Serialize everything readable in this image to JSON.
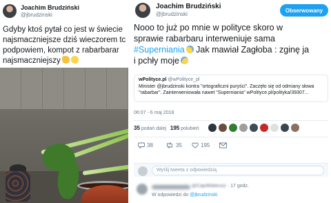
{
  "left_tweet": {
    "author_name": "Joachim Brudziński",
    "handle": "@jbrudzinski",
    "text_lines": [
      "Gdyby ktoś pytał co jest w świecie",
      "najsmaczniejsze dziś wieczorem tc",
      "podpowiem, kompot z rabarbarar",
      "najsmaczniejszy"
    ],
    "text_emojis": [
      "thumbs-up-emoji",
      "smile-emoji"
    ]
  },
  "right_tweet": {
    "author_name": "Joachim Brudziński",
    "handle": "@jbrudzinski",
    "follow_label": "Obserwowany",
    "text_line1": "Nooo to już po mnie w polityce skoro w",
    "text_line2": "sprawie rabarbaru interweniuje sama",
    "hashtag": "#Superniania",
    "text_line3_rest": " Jak mawiał Zagłoba : zginę ja",
    "text_line4": "i pchły moje",
    "quote": {
      "source_name": "wPolityce.pl",
      "source_handle": "@wPolityce_pl",
      "body_line1": "Minister @jbrudzinski kontra \"ortograficzni puryści\". Zaczęło się od odmiany słowa",
      "body_line2": "\"rabarbar\". Zainterweniowała nawet \"Superniania\" wPolityce.pl/polityka/39307..."
    },
    "timestamp": "06:07 - 6 maj 2018",
    "retweets_count": "35",
    "retweets_label": "podań dalej",
    "likes_count": "195",
    "likes_label": "polubień",
    "actions": {
      "reply_count": "38",
      "retweet_count": "35",
      "like_count": "195"
    },
    "reply_placeholder": "Wyślij tweeta z odpowiedzią",
    "comment": {
      "handle": "@CapitMateusz",
      "time": "· 17 godz.",
      "reply_prefix": "W odpowiedzi do",
      "reply_to": "@jbrudzinski"
    }
  },
  "colors": {
    "accent": "#1da1f2",
    "muted": "#657786",
    "text": "#14171a"
  }
}
